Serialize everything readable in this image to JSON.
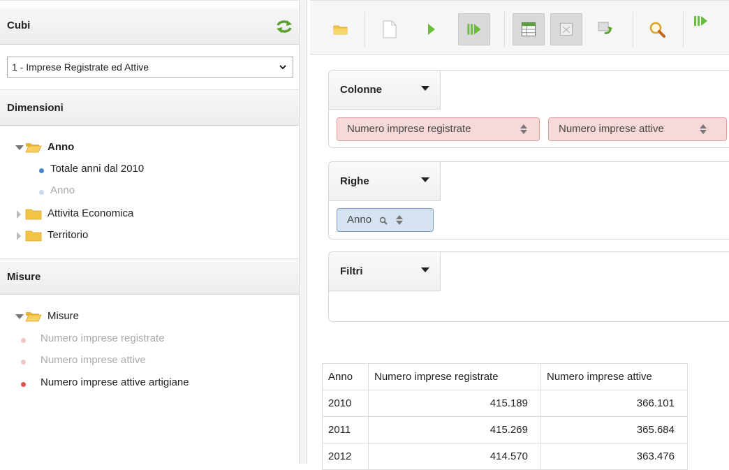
{
  "sidebar": {
    "cubi": {
      "title": "Cubi",
      "selected_cube": "1 - Imprese Registrate ed Attive"
    },
    "dimensioni": {
      "title": "Dimensioni",
      "tree": {
        "anno": {
          "label": "Anno",
          "children": [
            "Totale anni dal 2010",
            "Anno"
          ]
        },
        "attivita": {
          "label": "Attivita Economica"
        },
        "territorio": {
          "label": "Territorio"
        }
      }
    },
    "misure": {
      "title": "Misure",
      "folder": "Misure",
      "items": [
        "Numero imprese registrate",
        "Numero imprese attive",
        "Numero imprese attive artigiane"
      ]
    }
  },
  "toolbar": {
    "buttons": [
      "open-folder-icon",
      "new-document-icon",
      "run-icon",
      "auto-run-icon",
      "show-fields-icon",
      "hide-empty-icon",
      "swap-axes-icon",
      "zoom-icon",
      "drill-icon"
    ]
  },
  "zones": {
    "colonne": {
      "label": "Colonne",
      "chips": [
        "Numero imprese registrate",
        "Numero imprese attive"
      ]
    },
    "righe": {
      "label": "Righe",
      "chips": [
        "Anno"
      ]
    },
    "filtri": {
      "label": "Filtri"
    }
  },
  "table": {
    "headers": [
      "Anno",
      "Numero imprese registrate",
      "Numero imprese attive"
    ],
    "rows": [
      [
        "2010",
        "415.189",
        "366.101"
      ],
      [
        "2011",
        "415.269",
        "365.684"
      ],
      [
        "2012",
        "414.570",
        "363.476"
      ]
    ]
  },
  "colors": {
    "measure_red": "#f7d9d9",
    "dimension_blue": "#d6e4f2",
    "dot_blue": "#4a86c5",
    "dot_red": "#d9534f"
  }
}
